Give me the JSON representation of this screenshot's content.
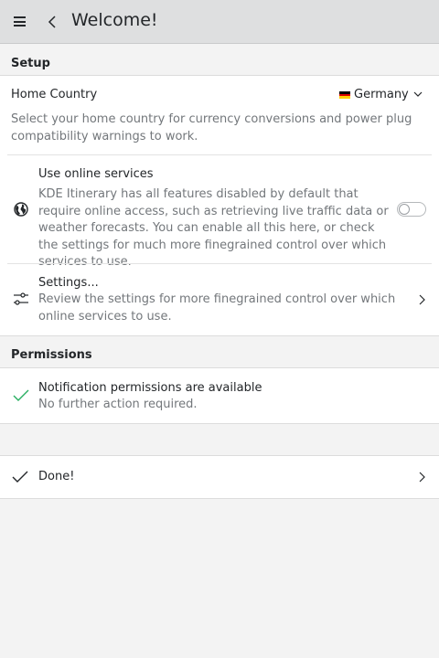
{
  "header": {
    "title": "Welcome!"
  },
  "setup": {
    "section_title": "Setup",
    "home_country": {
      "label": "Home Country",
      "value": "Germany",
      "description": "Select your home country for currency conversions and power plug compatibility warnings to work."
    },
    "online_services": {
      "label": "Use online services",
      "description": "KDE Itinerary has all features disabled by default that require online access, such as retrieving live traffic data or weather forecasts. You can enable all this here, or check the settings for much more finegrained control over which services to use.",
      "enabled": false
    },
    "settings": {
      "label": "Settings...",
      "description": "Review the settings for more finegrained control over which online services to use."
    }
  },
  "permissions": {
    "section_title": "Permissions",
    "notification": {
      "label": "Notification permissions are available",
      "description": "No further action required."
    }
  },
  "done": {
    "label": "Done!"
  },
  "colors": {
    "check_green": "#27ae60",
    "header_bg": "#dedfe0",
    "page_bg": "#f3f3f3"
  }
}
